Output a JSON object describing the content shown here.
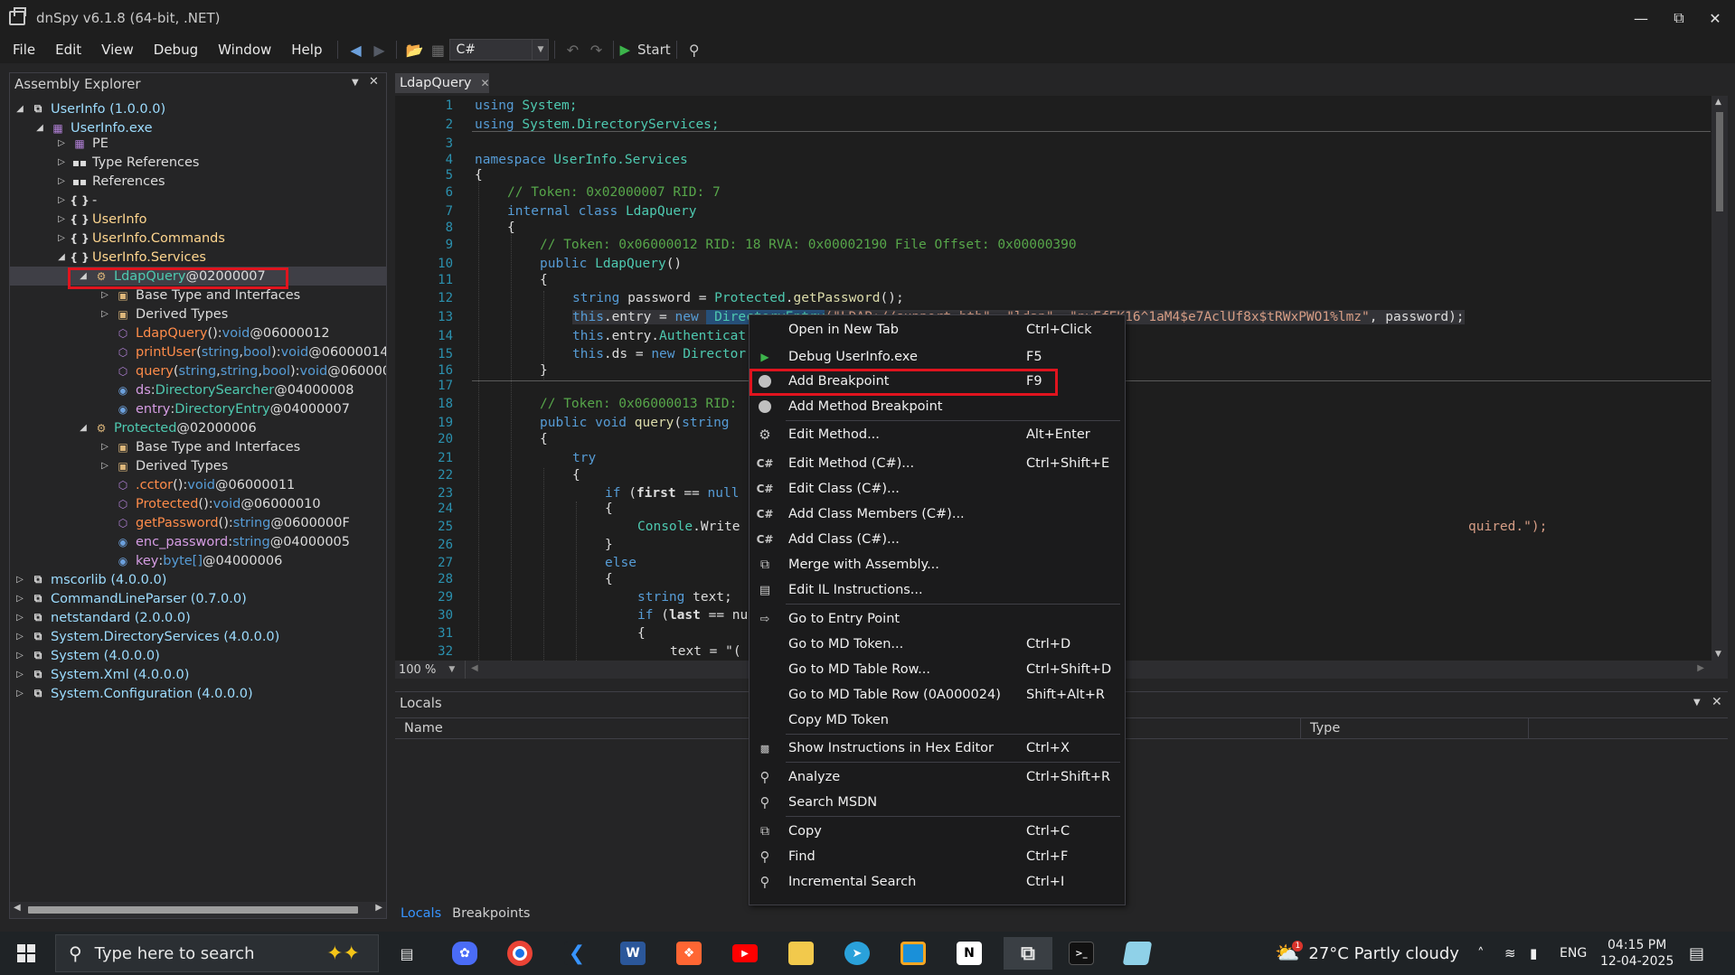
{
  "window": {
    "title": "dnSpy v6.1.8 (64-bit, .NET)"
  },
  "menubar": {
    "items": [
      "File",
      "Edit",
      "View",
      "Debug",
      "Window",
      "Help"
    ],
    "language": "C#",
    "start_label": "Start"
  },
  "assembly_explorer": {
    "title": "Assembly Explorer",
    "rows": [
      {
        "text": "UserInfo (1.0.0.0)"
      },
      {
        "text": "UserInfo.exe"
      },
      {
        "text": "PE"
      },
      {
        "text": "Type References"
      },
      {
        "text": "References"
      },
      {
        "text": "-"
      },
      {
        "text": "UserInfo"
      },
      {
        "text": "UserInfo.Commands"
      },
      {
        "text": "UserInfo.Services"
      },
      {
        "name": "LdapQuery",
        "suffix": " @02000007"
      },
      {
        "text": "Base Type and Interfaces"
      },
      {
        "text": "Derived Types"
      },
      {
        "name": "LdapQuery",
        "p1": "()",
        "colon": " : ",
        "type": "void",
        "tok": " @06000012"
      },
      {
        "name": "printUser",
        "p1": "(",
        "a1": "string",
        "c1": ", ",
        "a2": "bool",
        "p2": ")",
        "colon": " : ",
        "type": "void",
        "tok": " @06000014"
      },
      {
        "name": "query",
        "p1": "(",
        "a1": "string",
        "c1": ", ",
        "a2": "string",
        "c2": ", ",
        "a3": "bool",
        "p2": ")",
        "colon": " : ",
        "type": "void",
        "tok": " @060000"
      },
      {
        "name": "ds",
        "colon": " : ",
        "type": "DirectorySearcher",
        "tok": " @04000008"
      },
      {
        "name": "entry",
        "colon": " : ",
        "type": "DirectoryEntry",
        "tok": " @04000007"
      },
      {
        "name": "Protected",
        "suffix": " @02000006"
      },
      {
        "text": "Base Type and Interfaces"
      },
      {
        "text": "Derived Types"
      },
      {
        "name": ".cctor",
        "p1": "()",
        "colon": " : ",
        "type": "void",
        "tok": " @06000011"
      },
      {
        "name": "Protected",
        "p1": "()",
        "colon": " : ",
        "type": "void",
        "tok": " @06000010"
      },
      {
        "name": "getPassword",
        "p1": "()",
        "colon": " : ",
        "type": "string",
        "tok": " @0600000F"
      },
      {
        "name": "enc_password",
        "colon": " : ",
        "type": "string",
        "tok": " @04000005"
      },
      {
        "name": "key",
        "colon": " : ",
        "type": "byte[]",
        "tok": " @04000006"
      },
      {
        "text": "mscorlib (4.0.0.0)"
      },
      {
        "text": "CommandLineParser (0.7.0.0)"
      },
      {
        "text": "netstandard (2.0.0.0)"
      },
      {
        "text": "System.DirectoryServices (4.0.0.0)"
      },
      {
        "text": "System (4.0.0.0)"
      },
      {
        "text": "System.Xml (4.0.0.0)"
      },
      {
        "text": "System.Configuration (4.0.0.0)"
      }
    ]
  },
  "editor": {
    "tab_label": "LdapQuery",
    "zoom": "100 %",
    "line_numbers": [
      "1",
      "2",
      "3",
      "4",
      "5",
      "6",
      "7",
      "8",
      "9",
      "10",
      "11",
      "12",
      "13",
      "14",
      "15",
      "16",
      "17",
      "18",
      "19",
      "20",
      "21",
      "22",
      "23",
      "24",
      "25",
      "26",
      "27",
      "28",
      "29",
      "30",
      "31",
      "32"
    ],
    "code": {
      "l1_kw": "using",
      "l1_ns": " System;",
      "l2_kw": "using",
      "l2_ns": " System.DirectoryServices;",
      "l4_kw": "namespace",
      "l4_ns": " UserInfo.Services",
      "l5": "{",
      "l6": "// Token: 0x02000007 RID: 7",
      "l7_kw": "internal class",
      "l7_t": " LdapQuery",
      "l8": "{",
      "l9": "// Token: 0x06000012 RID: 18 RVA: 0x00002190 File Offset: 0x00000390",
      "l10_kw": "public",
      "l10_t": " LdapQuery",
      "l10_p": "()",
      "l11": "{",
      "l12_kw": "string",
      "l12_a": " password = ",
      "l12_t": "Protected",
      "l12_b": ".",
      "l12_m": "getPassword",
      "l12_c": "();",
      "l13_kw": "this",
      "l13_a": ".entry = ",
      "l13_kw2": "new",
      "l13_t": " Dire",
      "l13_hidden": "ctoryEntry",
      "l13_s1": "(\"LDAP://",
      "l13_s2": "support.htb\", \"ldap\", \"nvEfEK16^1aM4$e7AclUf8x$tRWxPWO1%lmz\"",
      "l13_end": ", password);",
      "l14_kw": "this",
      "l14_a": ".entry.",
      "l14_t": "Authenticat",
      "l15_kw": "this",
      "l15_a": ".ds = ",
      "l15_kw2": "new",
      "l15_t": " Director",
      "l16": "}",
      "l18": "// Token: 0x06000013 RID:",
      "l19_kw": "public void",
      "l19_m": " query",
      "l19_p": "(",
      "l19_kw2": "string",
      "l20": "{",
      "l21_kw": "try",
      "l22": "{",
      "l23_kw": "if",
      "l23_a": " (",
      "l23_b": "first",
      "l23_c": " == ",
      "l23_kw2": "null",
      "l24": "{",
      "l25_t": "Console",
      "l25_a": ".Write",
      "l25_s": "quired.\");",
      "l26": "}",
      "l27_kw": "else",
      "l28": "{",
      "l29_kw": "string",
      "l29_a": " text;",
      "l30_kw": "if",
      "l30_a": " (",
      "l30_b": "last",
      "l30_c": " == nu",
      "l31": "{",
      "l32_a": "text = \"("
    }
  },
  "context_menu": {
    "items": [
      {
        "label": "Open in New Tab",
        "shortcut": "Ctrl+Click",
        "icon": "none"
      },
      {
        "label": "Debug UserInfo.exe",
        "shortcut": "F5",
        "icon": "play-icon"
      },
      {
        "label": "Add Breakpoint",
        "shortcut": "F9",
        "icon": "breakpoint-dot-icon"
      },
      {
        "label": "Add Method Breakpoint",
        "shortcut": "",
        "icon": "breakpoint-dot-icon"
      },
      {
        "label": "Edit Method...",
        "shortcut": "Alt+Enter",
        "icon": "gear-icon"
      },
      {
        "label": "Edit Method (C#)...",
        "shortcut": "Ctrl+Shift+E",
        "icon": "csharp-icon"
      },
      {
        "label": "Edit Class (C#)...",
        "shortcut": "",
        "icon": "csharp-icon"
      },
      {
        "label": "Add Class Members (C#)...",
        "shortcut": "",
        "icon": "csharp-icon"
      },
      {
        "label": "Add Class (C#)...",
        "shortcut": "",
        "icon": "csharp-icon"
      },
      {
        "label": "Merge with Assembly...",
        "shortcut": "",
        "icon": "merge-icon"
      },
      {
        "label": "Edit IL Instructions...",
        "shortcut": "",
        "icon": "il-icon"
      },
      {
        "label": "Go to Entry Point",
        "shortcut": "",
        "icon": "entry-point-icon"
      },
      {
        "label": "Go to MD Token...",
        "shortcut": "Ctrl+D",
        "icon": "none"
      },
      {
        "label": "Go to MD Table Row...",
        "shortcut": "Ctrl+Shift+D",
        "icon": "none"
      },
      {
        "label": "Go to MD Table Row (0A000024)",
        "shortcut": "Shift+Alt+R",
        "icon": "none"
      },
      {
        "label": "Copy MD Token",
        "shortcut": "",
        "icon": "none"
      },
      {
        "label": "Show Instructions in Hex Editor",
        "shortcut": "Ctrl+X",
        "icon": "hex-icon"
      },
      {
        "label": "Analyze",
        "shortcut": "Ctrl+Shift+R",
        "icon": "search-icon"
      },
      {
        "label": "Search MSDN",
        "shortcut": "",
        "icon": "search-icon"
      },
      {
        "label": "Copy",
        "shortcut": "Ctrl+C",
        "icon": "copy-icon"
      },
      {
        "label": "Find",
        "shortcut": "Ctrl+F",
        "icon": "search-icon"
      },
      {
        "label": "Incremental Search",
        "shortcut": "Ctrl+I",
        "icon": "search-icon"
      }
    ]
  },
  "locals": {
    "title": "Locals",
    "columns": [
      "Name",
      "Type"
    ],
    "tabs": [
      "Locals",
      "Breakpoints"
    ]
  },
  "taskbar": {
    "search_placeholder": "Type here to search",
    "weather": "27°C  Partly cloudy",
    "weather_badge": "1",
    "language": "ENG",
    "time": "04:15 PM",
    "date": "12-04-2025"
  },
  "colors": {
    "accent_red": "#e0141e",
    "link_blue": "#3794ff",
    "background": "#252526"
  }
}
